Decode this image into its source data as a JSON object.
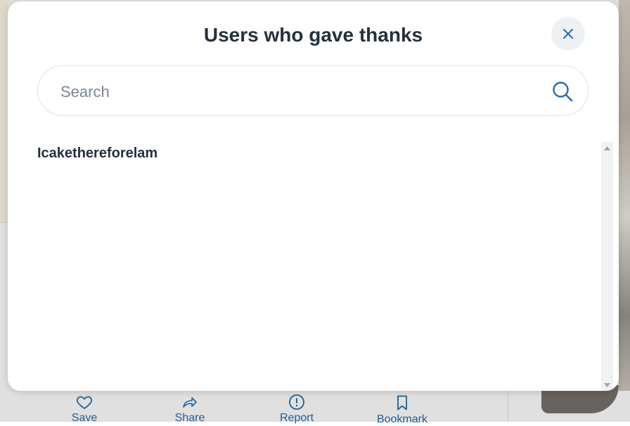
{
  "modal": {
    "title": "Users who gave thanks",
    "search": {
      "placeholder": "Search",
      "value": ""
    },
    "users": [
      "Icakethereforelam"
    ]
  },
  "background": {
    "actions": [
      {
        "label": "Save",
        "icon": "heart-icon"
      },
      {
        "label": "Share",
        "icon": "share-arrow-icon"
      },
      {
        "label": "Report",
        "icon": "alert-circle-icon"
      },
      {
        "label": "Bookmark",
        "icon": "bookmark-icon"
      }
    ]
  },
  "colors": {
    "accent": "#1f6fb0",
    "title_text": "#22313f",
    "close_bg": "#eef1f4"
  }
}
